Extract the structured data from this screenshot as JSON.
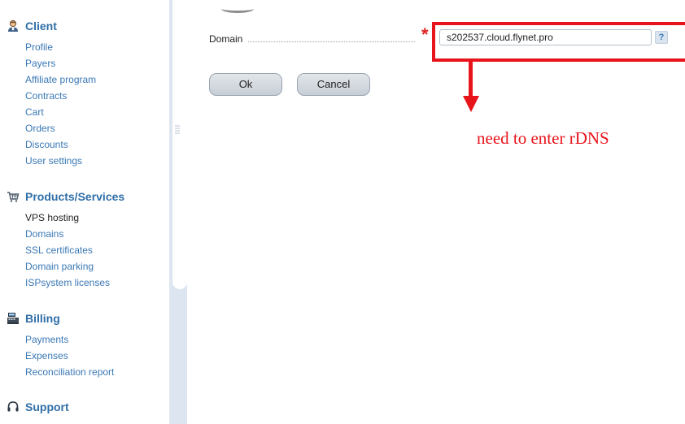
{
  "sidebar": {
    "client": {
      "title": "Client",
      "items": [
        "Profile",
        "Payers",
        "Affiliate program",
        "Contracts",
        "Cart",
        "Orders",
        "Discounts",
        "User settings"
      ]
    },
    "products": {
      "title": "Products/Services",
      "items": [
        "VPS hosting",
        "Domains",
        "SSL certificates",
        "Domain parking",
        "ISPsystem licenses"
      ],
      "active_index": 0
    },
    "billing": {
      "title": "Billing",
      "items": [
        "Payments",
        "Expenses",
        "Reconciliation report"
      ]
    },
    "support": {
      "title": "Support"
    }
  },
  "form": {
    "domain_label": "Domain",
    "required_mark": "*",
    "domain_value": "s202537.cloud.flynet.pro",
    "help_label": "?",
    "ok_label": "Ok",
    "cancel_label": "Cancel"
  },
  "annotation": {
    "text": "need to enter rDNS",
    "color": "#e8141c"
  },
  "colors": {
    "link": "#3a78b5",
    "section_head": "#2f6ea7",
    "splitter": "#dde6f0"
  },
  "icons": {
    "client": "user-icon",
    "products": "cart-icon",
    "billing": "cash-register-icon",
    "support": "headset-icon",
    "help": "question-icon"
  }
}
